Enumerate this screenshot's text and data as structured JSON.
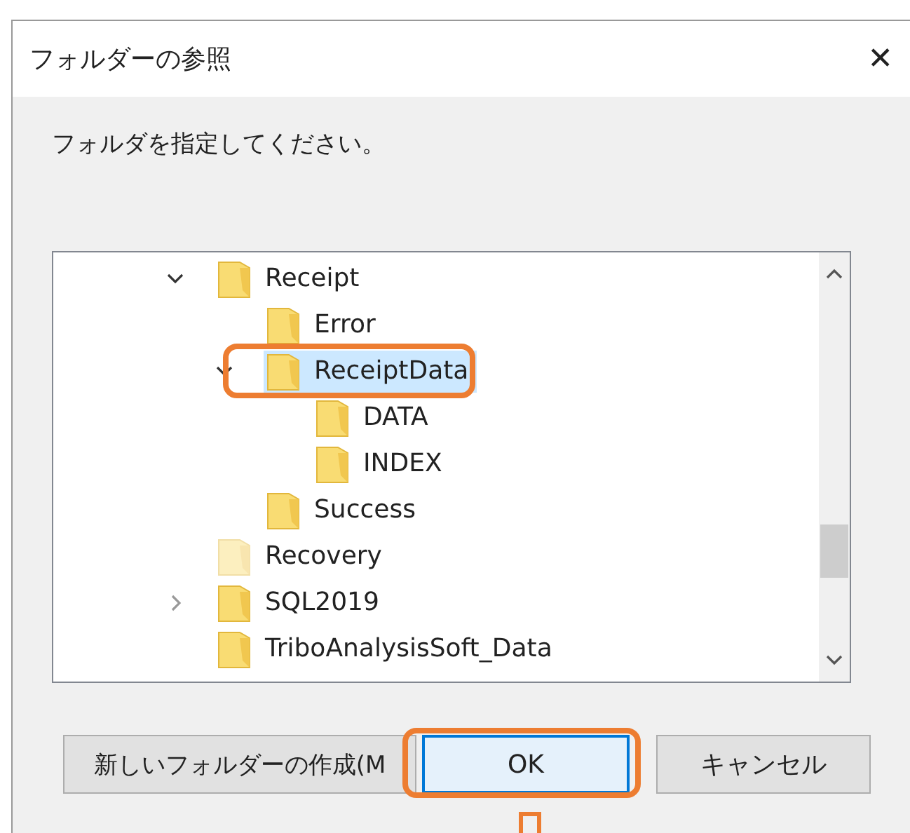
{
  "window": {
    "title": "フォルダーの参照",
    "close": "✕"
  },
  "instruction": "フォルダを指定してください。",
  "tree": [
    {
      "label": "Receipt",
      "expanded": true,
      "selected": false,
      "children": [
        {
          "label": "Error",
          "selected": false
        },
        {
          "label": "ReceiptData",
          "expanded": true,
          "selected": true,
          "highlighted": true,
          "children": [
            {
              "label": "DATA",
              "selected": false
            },
            {
              "label": "INDEX",
              "selected": false
            }
          ]
        },
        {
          "label": "Success",
          "selected": false
        }
      ]
    },
    {
      "label": "Recovery",
      "selected": false,
      "faded": true
    },
    {
      "label": "SQL2019",
      "expanded": false,
      "selected": false
    },
    {
      "label": "TriboAnalysisSoft_Data",
      "selected": false
    }
  ],
  "buttons": [
    {
      "label": "新しいフォルダーの作成(M",
      "default": false
    },
    {
      "label": "OK",
      "default": true,
      "highlighted": true
    },
    {
      "label": "キャンセル",
      "default": false
    }
  ]
}
